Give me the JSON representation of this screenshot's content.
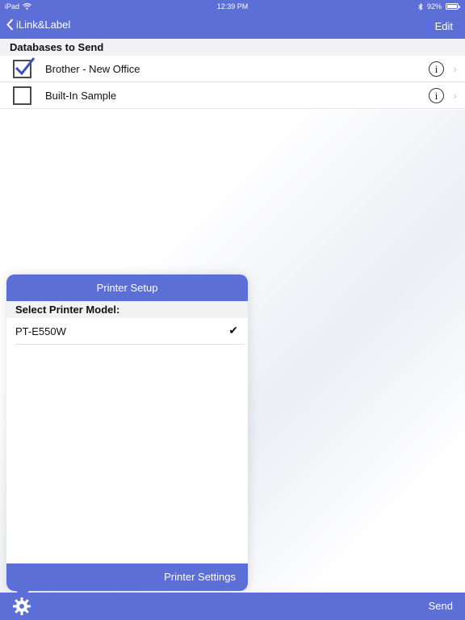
{
  "status": {
    "device": "iPad",
    "time": "12:39 PM",
    "battery": "92%"
  },
  "nav": {
    "back_label": "iLink&Label",
    "edit_label": "Edit"
  },
  "databases": {
    "section_title": "Databases to Send",
    "items": [
      {
        "label": "Brother - New Office",
        "checked": true
      },
      {
        "label": "Built-In Sample",
        "checked": false
      }
    ]
  },
  "printer_setup": {
    "title": "Printer Setup",
    "section_title": "Select Printer Model:",
    "models": [
      {
        "label": "PT-E550W",
        "selected": true
      }
    ],
    "footer_label": "Printer Settings"
  },
  "toolbar": {
    "send_label": "Send"
  },
  "colors": {
    "accent": "#5b6fd6",
    "check": "#3a4fbf"
  },
  "icons": {
    "back": "chevron-left-icon",
    "wifi": "wifi-icon",
    "bluetooth": "bluetooth-icon",
    "info": "info-icon",
    "disclosure": "chevron-right-icon",
    "check": "checkmark-icon",
    "settings": "gear-icon"
  }
}
